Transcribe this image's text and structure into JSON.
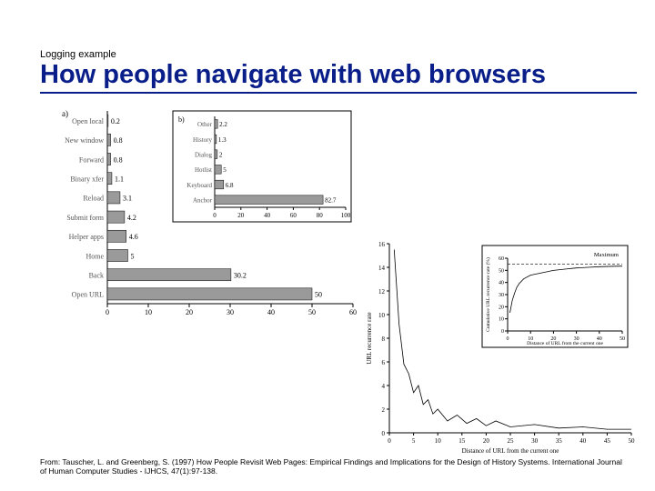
{
  "header": {
    "kicker": "Logging example",
    "title": "How people navigate with web browsers"
  },
  "citation": "From: Tauscher, L. and Greenberg, S. (1997) How People Revisit Web Pages: Empirical Findings and Implications for the Design of History Systems. International Journal of Human Computer Studies - IJHCS, 47(1):97-138.",
  "chart_data": [
    {
      "type": "bar",
      "id": "a_main",
      "label": "a)",
      "orientation": "horizontal",
      "categories": [
        "Open local",
        "New window",
        "Forward",
        "Binary xfer",
        "Reload",
        "Submit form",
        "Helper apps",
        "Home",
        "Back",
        "Open URL"
      ],
      "values": [
        0.2,
        0.8,
        0.8,
        1.1,
        3.1,
        4.2,
        4.6,
        5.0,
        30.2,
        50.0
      ],
      "xlim": [
        0,
        60
      ],
      "xticks": [
        0,
        10,
        20,
        30,
        40,
        50,
        60
      ]
    },
    {
      "type": "bar",
      "id": "b_inset",
      "label": "b)",
      "orientation": "horizontal",
      "categories": [
        "Other",
        "History",
        "Dialog",
        "Hotlist",
        "Keyboard",
        "Anchor"
      ],
      "values": [
        2.2,
        1.3,
        2.0,
        5.0,
        6.8,
        82.7
      ],
      "xlim": [
        0,
        100
      ],
      "xticks": [
        0,
        20,
        40,
        60,
        80,
        100
      ]
    },
    {
      "type": "line",
      "id": "recurrence_main",
      "xlabel": "Distance of URL from the current one",
      "ylabel": "URL recurrence rate",
      "xlim": [
        0,
        50
      ],
      "ylim": [
        0,
        16
      ],
      "yticks": [
        0,
        2,
        4,
        6,
        8,
        10,
        12,
        14,
        16
      ],
      "x": [
        1,
        2,
        3,
        4,
        5,
        6,
        7,
        8,
        9,
        10,
        12,
        14,
        16,
        18,
        20,
        22,
        25,
        30,
        35,
        40,
        45,
        50
      ],
      "y": [
        15.5,
        9.2,
        5.8,
        5.0,
        3.4,
        4.0,
        2.4,
        2.8,
        1.6,
        2.0,
        1.0,
        1.5,
        0.8,
        1.2,
        0.6,
        1.0,
        0.5,
        0.7,
        0.4,
        0.5,
        0.3,
        0.3
      ]
    },
    {
      "type": "line",
      "id": "cumulative_inset",
      "xlabel": "Distance of URL from the current one",
      "ylabel": "Cumulative URL recurrence rate (%)",
      "annotation": "Maximum",
      "xlim": [
        0,
        50
      ],
      "ylim": [
        0,
        60
      ],
      "x": [
        1,
        2,
        3,
        4,
        5,
        7,
        10,
        15,
        20,
        25,
        30,
        35,
        40,
        45,
        50
      ],
      "y": [
        15,
        25,
        31,
        36,
        39,
        43,
        46,
        48,
        50,
        51,
        52,
        52.5,
        53,
        53.3,
        53.5
      ]
    }
  ]
}
